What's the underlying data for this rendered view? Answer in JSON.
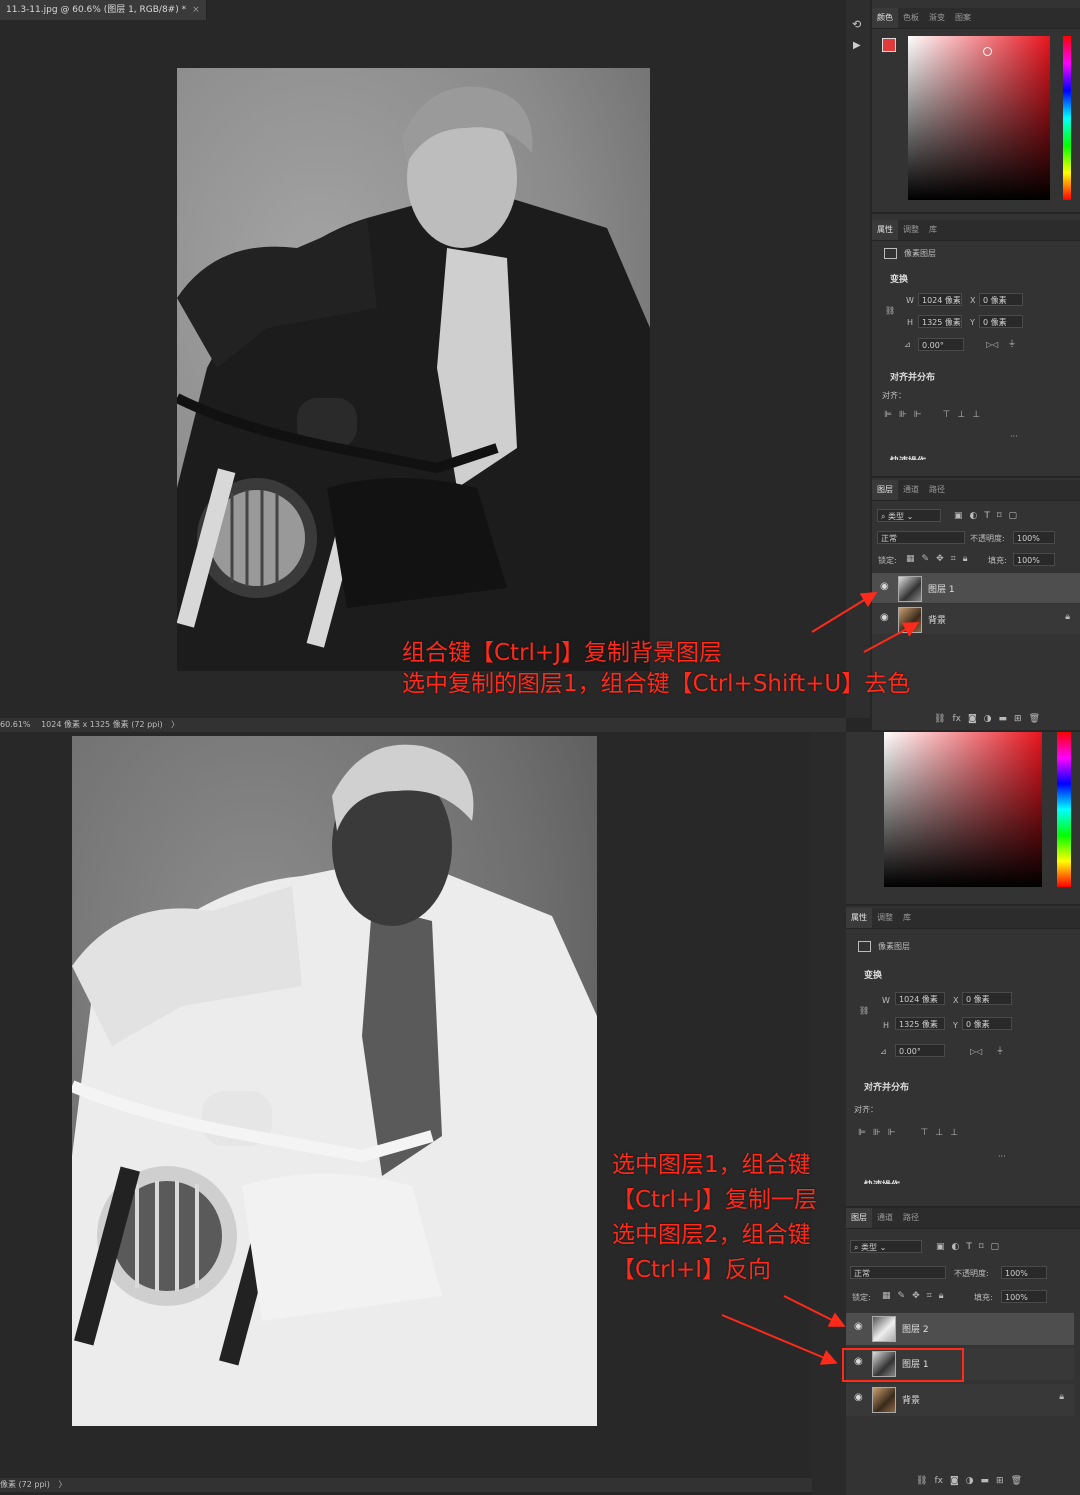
{
  "top": {
    "document_tab": "11.3-11.jpg @ 60.6% (图层 1, RGB/8#) *",
    "tab_close": "×",
    "status_zoom": "60.61%",
    "status_info": "1024 像素 x 1325 像素 (72 ppi)",
    "status_arrow": "〉",
    "color_tabs": [
      "颜色",
      "色板",
      "渐变",
      "图案"
    ],
    "props_tabs": [
      "属性",
      "调整",
      "库"
    ],
    "layers_tabs": [
      "图层",
      "通道",
      "路径"
    ],
    "annotation_lines": [
      "组合键【Ctrl+J】复制背景图层",
      "选中复制的图层1，组合键【Ctrl+Shift+U】去色"
    ],
    "layers": [
      {
        "name": "图层 1",
        "selected": true
      },
      {
        "name": "背景",
        "selected": false,
        "locked": true
      }
    ]
  },
  "bottom": {
    "status_info": "像素 (72 ppi)",
    "status_arrow": "〉",
    "props_tabs": [
      "属性",
      "调整",
      "库"
    ],
    "layers_tabs": [
      "图层",
      "通道",
      "路径"
    ],
    "annotation_lines": [
      "选中图层1，组合键",
      "【Ctrl+J】复制一层",
      "选中图层2，组合键",
      "【Ctrl+I】反向"
    ],
    "layers": [
      {
        "name": "图层 2",
        "selected": true
      },
      {
        "name": "图层 1",
        "selected": false,
        "highlighted": true
      },
      {
        "name": "背景",
        "selected": false,
        "locked": true
      }
    ]
  },
  "properties": {
    "pixel_layer": "像素图层",
    "transform": "变换",
    "w_label": "W",
    "w_value": "1024 像素",
    "h_label": "H",
    "h_value": "1325 像素",
    "x_label": "X",
    "x_value": "0 像素",
    "y_label": "Y",
    "y_value": "0 像素",
    "angle": "0.00°",
    "align_distribute": "对齐并分布",
    "align": "对齐：",
    "more": "···",
    "cut_section": "快速操作"
  },
  "layers_panel": {
    "filter_kind": "类型",
    "blend_mode": "正常",
    "opacity_label": "不透明度:",
    "opacity_value": "100%",
    "lock_label": "锁定:",
    "fill_label": "填充:",
    "fill_value": "100%"
  },
  "colors": {
    "accent_red": "#ff2a1a",
    "foreground_swatch": "#e03a3a",
    "picker_hue": "#e8141e"
  }
}
